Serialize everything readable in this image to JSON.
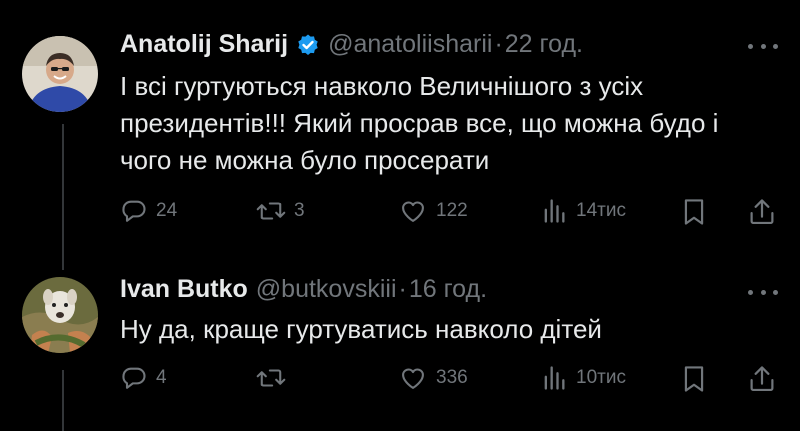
{
  "tweets": [
    {
      "name": "Anatolij Sharij",
      "verified": true,
      "handle": "@anatoliisharii",
      "separator": "·",
      "time": "22 год.",
      "text": "І всі гуртуються навколо Величнішого з усіх президентів!!! Який просрав все, що можна будо і чого не можна було просерати",
      "replies": "24",
      "retweets": "3",
      "likes": "122",
      "views": "14тис"
    },
    {
      "name": "Ivan Butko",
      "verified": false,
      "handle": "@butkovskiii",
      "separator": "·",
      "time": "16 год.",
      "text": "Ну да, краще гуртуватись навколо дітей",
      "replies": "4",
      "retweets": "",
      "likes": "336",
      "views": "10тис"
    }
  ],
  "colors": {
    "background": "#000000",
    "text": "#e7e9ea",
    "secondary": "#71767b",
    "verified": "#1d9bf0"
  },
  "icons": [
    "verified-badge-icon",
    "more-icon",
    "reply-icon",
    "retweet-icon",
    "like-icon",
    "views-icon",
    "bookmark-icon",
    "share-icon"
  ]
}
